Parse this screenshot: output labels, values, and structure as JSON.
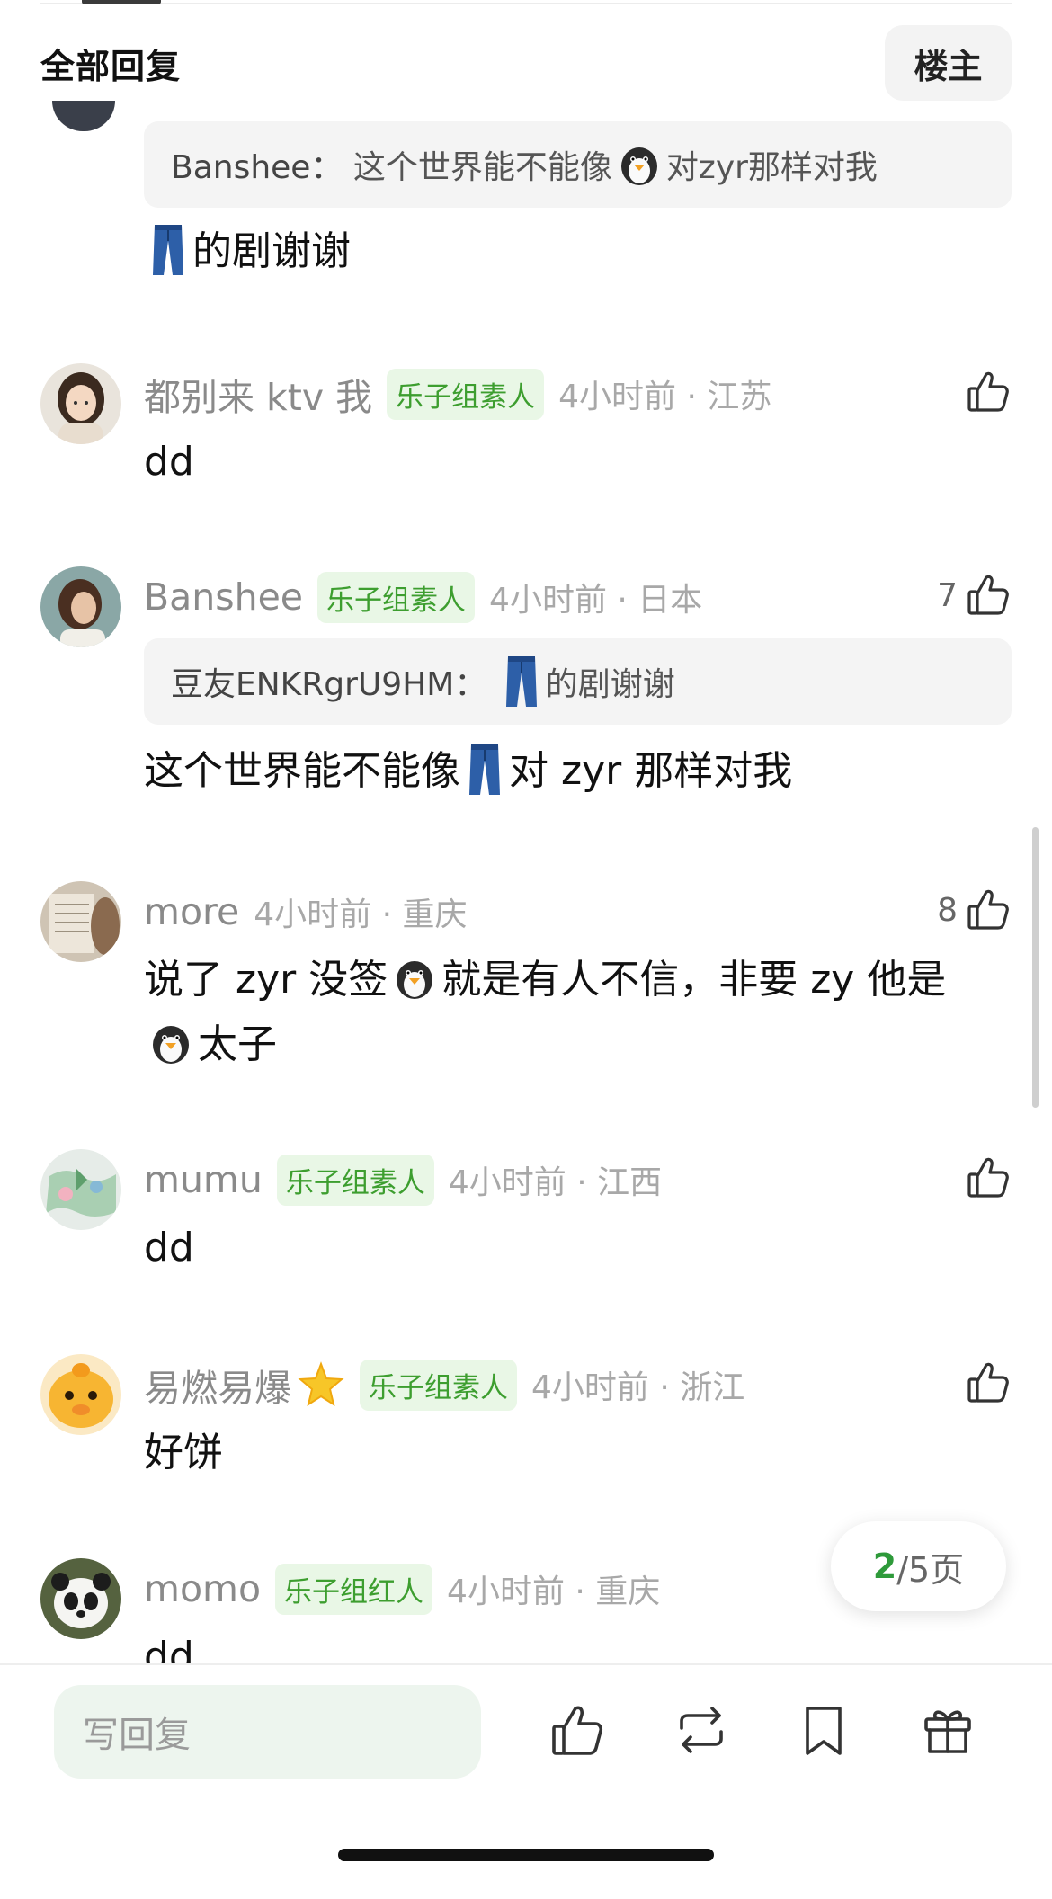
{
  "header": {
    "title": "全部回复",
    "op_label": "楼主"
  },
  "top_fragment": {
    "quote_name": "Banshee：",
    "quote_text_a": "这个世界能不能像",
    "quote_text_b": "对zyr那样对我",
    "reply_text": "的剧谢谢"
  },
  "comments": [
    {
      "username": "都别来 ktv 我",
      "badge": "乐子组素人",
      "time": "4小时前 · 江苏",
      "likes": "",
      "text": "dd"
    },
    {
      "username": "Banshee",
      "badge": "乐子组素人",
      "time": "4小时前 · 日本",
      "likes": "7",
      "quote_name": "豆友ENKRgrU9HM：",
      "quote_text": "的剧谢谢",
      "text_a": "这个世界能不能像",
      "text_b": "对 zyr 那样对我"
    },
    {
      "username": "more",
      "badge": "",
      "time": "4小时前 · 重庆",
      "likes": "8",
      "text_a": "说了 zyr 没签",
      "text_b": "就是有人不信，非要 zy 他是",
      "text_c": "太子"
    },
    {
      "username": "mumu",
      "badge": "乐子组素人",
      "time": "4小时前 · 江西",
      "likes": "",
      "text": "dd"
    },
    {
      "username": "易燃易爆",
      "badge": "乐子组素人",
      "time": "4小时前 · 浙江",
      "likes": "",
      "text": "好饼"
    },
    {
      "username": "momo",
      "badge": "乐子组红人",
      "time": "4小时前 · 重庆",
      "likes": "",
      "text": "dd"
    }
  ],
  "pagination": {
    "current": "2",
    "total_suffix": "/5页"
  },
  "bottom_bar": {
    "reply_placeholder": "写回复",
    "icons": [
      "thumb-up-icon",
      "repost-icon",
      "bookmark-icon",
      "gift-icon"
    ]
  },
  "colors": {
    "accent_green": "#2e9a3a",
    "badge_bg": "#e9f7e6",
    "badge_text": "#3d9e2f",
    "input_bg": "#edf5ee"
  }
}
